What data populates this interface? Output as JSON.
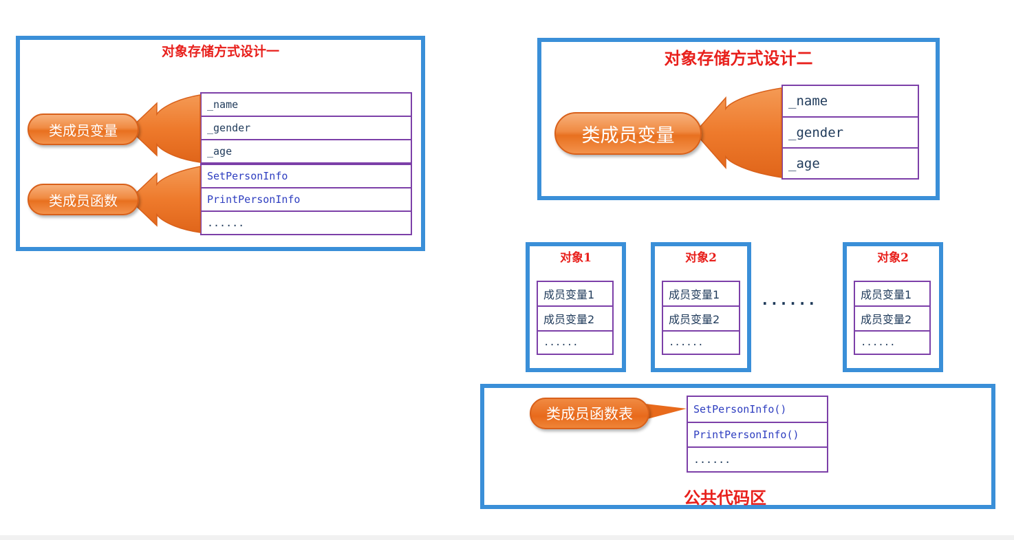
{
  "design1": {
    "title": "对象存储方式设计一",
    "var_label": "类成员变量",
    "func_label": "类成员函数",
    "vars": [
      "_name",
      "_gender",
      "_age"
    ],
    "funcs": [
      "SetPersonInfo",
      "PrintPersonInfo",
      "......"
    ]
  },
  "design2": {
    "title": "对象存储方式设计二",
    "var_label": "类成员变量",
    "vars": [
      "_name",
      "_gender",
      "_age"
    ],
    "objects": [
      {
        "title": "对象1",
        "rows": [
          "成员变量1",
          "成员变量2",
          "......"
        ]
      },
      {
        "title": "对象2",
        "rows": [
          "成员变量1",
          "成员变量2",
          "......"
        ]
      },
      {
        "title": "对象2",
        "rows": [
          "成员变量1",
          "成员变量2",
          "......"
        ]
      }
    ],
    "ellipsis": "......",
    "code_area": {
      "label": "类成员函数表",
      "funcs": [
        "SetPersonInfo()",
        "PrintPersonInfo()",
        "......"
      ],
      "caption": "公共代码区"
    }
  },
  "colors": {
    "frame": "#3a8fd8",
    "title": "#e8201c",
    "table_border": "#7c3fa8",
    "pill": "#f08a42"
  }
}
